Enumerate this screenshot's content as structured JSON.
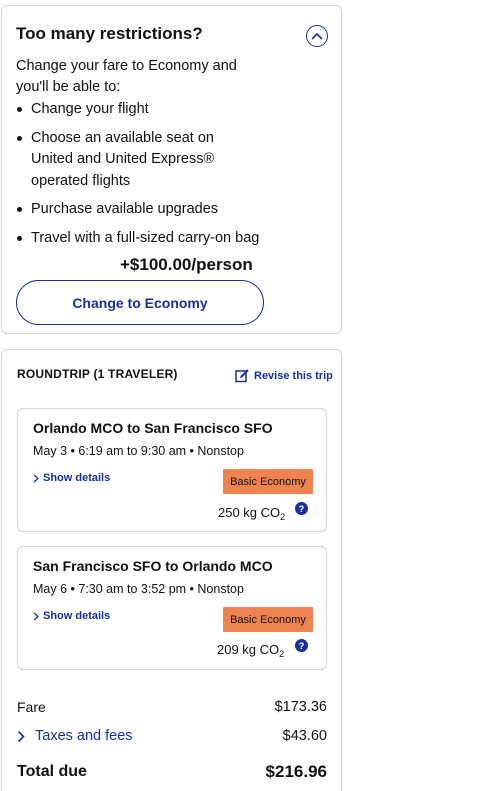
{
  "restrictions": {
    "title": "Too many restrictions?",
    "intro": "Change your fare to Economy and you'll be able to:",
    "benefits": [
      "Change your flight",
      "Choose an available seat on United and United Express® operated flights",
      "Purchase available upgrades",
      "Travel with a full-sized carry-on bag"
    ],
    "price": "+$100.00/person",
    "button_label": "Change to Economy",
    "collapse_icon": "chevron-up-icon"
  },
  "trip": {
    "type_label": "ROUNDTRIP (1 TRAVELER)",
    "revise_label": "Revise this trip",
    "flights": [
      {
        "route": "Orlando MCO to San Francisco SFO",
        "schedule": "May 3 • 6:19 am to 9:30 am • Nonstop",
        "details_label": "Show details",
        "fare_class": "Basic Economy",
        "co2_value": "250 kg CO",
        "co2_sub": "2"
      },
      {
        "route": "San Francisco SFO to Orlando MCO",
        "schedule": "May 6 • 7:30 am to 3:52 pm • Nonstop",
        "details_label": "Show details",
        "fare_class": "Basic Economy",
        "co2_value": "209 kg CO",
        "co2_sub": "2"
      }
    ],
    "fare_label": "Fare",
    "fare_value": "$173.36",
    "taxes_label": "Taxes and fees",
    "taxes_value": "$43.60",
    "total_label": "Total due",
    "total_value": "$216.96"
  },
  "colors": {
    "accent": "#1a2e9c",
    "badge": "#ef8350",
    "border": "#d5d5d5"
  }
}
